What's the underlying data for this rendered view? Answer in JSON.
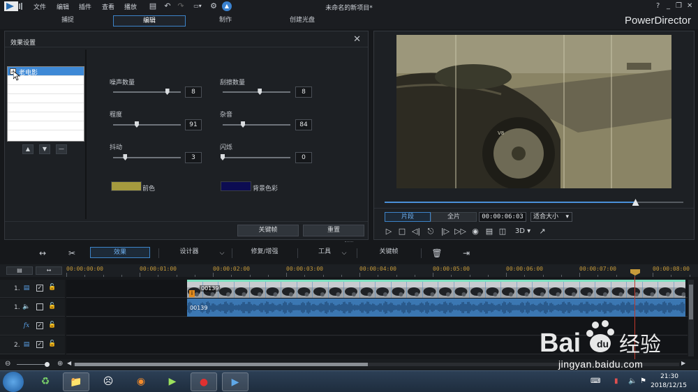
{
  "menu": [
    "文件",
    "编辑",
    "插件",
    "查看",
    "播放"
  ],
  "app_title": "未命名的新项目*",
  "window_controls": [
    "?",
    "_",
    "❐",
    "✕"
  ],
  "tabs": [
    {
      "label": "捕捉",
      "active": false
    },
    {
      "label": "编辑",
      "active": true
    },
    {
      "label": "制作",
      "active": false
    },
    {
      "label": "创建光盘",
      "active": false
    }
  ],
  "brand": "PowerDirector",
  "effect_panel": {
    "title": "效果设置",
    "list": [
      {
        "label": "老电影",
        "checked": true,
        "selected": true
      }
    ],
    "params": [
      {
        "label": "噪声数量",
        "value": "8",
        "fraction": 0.8
      },
      {
        "label": "刮擦数量",
        "value": "8",
        "fraction": 0.55
      },
      {
        "label": "程度",
        "value": "91",
        "fraction": 0.35
      },
      {
        "label": "杂音",
        "value": "84",
        "fraction": 0.3
      },
      {
        "label": "抖动",
        "value": "3",
        "fraction": 0.18
      },
      {
        "label": "闪烁",
        "value": "0",
        "fraction": 0.0
      }
    ],
    "fg_color": {
      "label": "前色",
      "color": "#a59a3e"
    },
    "bg_color": {
      "label": "背景色彩",
      "color": "#0c0c52"
    },
    "keyframe_button": "关键帧",
    "reset_button": "重置"
  },
  "preview": {
    "clip_button": "片段",
    "full_button": "全片",
    "timecode": "00:00:06:03",
    "fit_option": "适合大小",
    "mode_3d": "3D",
    "progress": 0.84
  },
  "edit_toolbar": {
    "effect_button": "效果",
    "designer_button": "设计器",
    "repair_button": "修复/增强",
    "tools_button": "工具",
    "keyframe_button": "关键帧"
  },
  "timeline": {
    "ticks": [
      "00:00:00:00",
      "00:00:01:00",
      "00:00:02:00",
      "00:00:03:00",
      "00:00:04:00",
      "00:00:05:00",
      "00:00:06:00",
      "00:00:07:00",
      "00:00:08:00"
    ],
    "tracks": [
      {
        "label": "1.",
        "kind": "video"
      },
      {
        "label": "1.",
        "kind": "audio"
      },
      {
        "label": "",
        "kind": "fx"
      },
      {
        "label": "2.",
        "kind": "video"
      }
    ],
    "video_clip_name": "00139",
    "audio_clip_name": "00139"
  },
  "clock": {
    "time": "21:30",
    "date": "2018/12/15"
  },
  "watermark": {
    "text": "jingyan.baidu.com",
    "logo": "Bai du 经验"
  }
}
